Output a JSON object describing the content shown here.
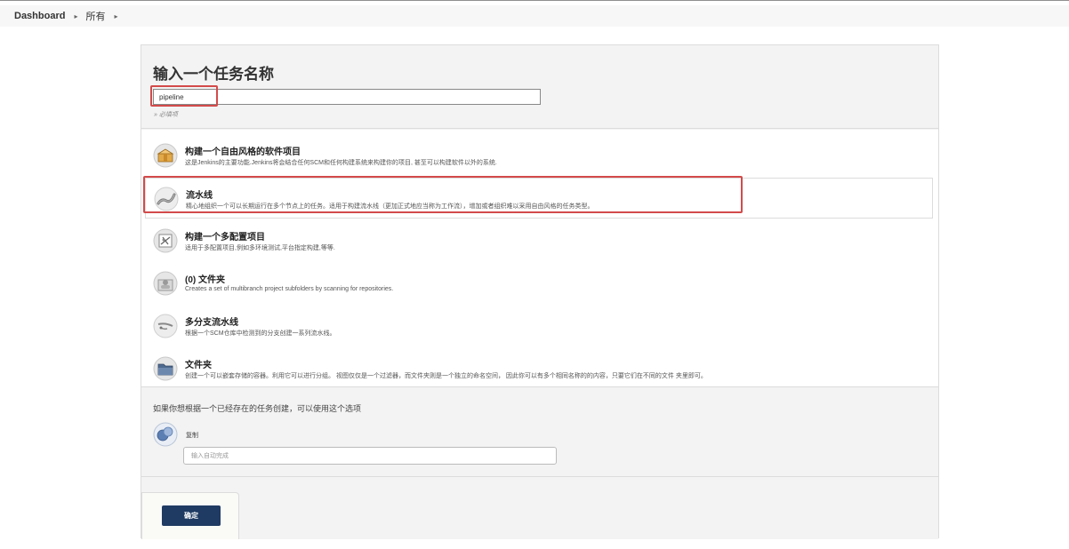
{
  "breadcrumb": {
    "items": [
      {
        "label": "Dashboard"
      },
      {
        "label": "所有"
      }
    ],
    "separator": "▸"
  },
  "header": {
    "title": "输入一个任务名称",
    "name_value": "pipeline",
    "required_hint": "» 必填项"
  },
  "item_types": [
    {
      "label": "构建一个自由风格的软件项目",
      "desc": "这是Jenkins的主要功能.Jenkins将会结合任何SCM和任何构建系统来构建你的项目, 甚至可以构建软件以外的系统.",
      "icon": "freestyle-package-icon"
    },
    {
      "label": "流水线",
      "desc": "精心地组织一个可以长期运行在多个节点上的任务。适用于构建流水线（更加正式地应当称为工作流），增加或者组织难以采用自由风格的任务类型。",
      "icon": "pipeline-icon"
    },
    {
      "label": "构建一个多配置项目",
      "desc": "适用于多配置项目,例如多环境测试,平台指定构建,等等.",
      "icon": "multi-config-icon"
    },
    {
      "label": "(0) 文件夹",
      "desc": "Creates a set of multibranch project subfolders by scanning for repositories.",
      "icon": "org-folder-icon"
    },
    {
      "label": "多分支流水线",
      "desc": "根据一个SCM仓库中检测到的分支创建一系列流水线。",
      "icon": "multibranch-pipeline-icon"
    },
    {
      "label": "文件夹",
      "desc": "创建一个可以嵌套存储的容器。利用它可以进行分组。 视图仅仅是一个过滤器，而文件夹则是一个独立的命名空间， 因此你可以有多个相同名称的的内容，只要它们在不同的文件 夹里即可。",
      "icon": "folder-icon"
    }
  ],
  "copy": {
    "title": "如果你想根据一个已经存在的任务创建，可以使用这个选项",
    "label": "复制",
    "placeholder": "输入自动完成"
  },
  "footer": {
    "ok_label": "确定"
  },
  "colors": {
    "highlight": "#d34a4a",
    "button_bg": "#1f3b63"
  }
}
